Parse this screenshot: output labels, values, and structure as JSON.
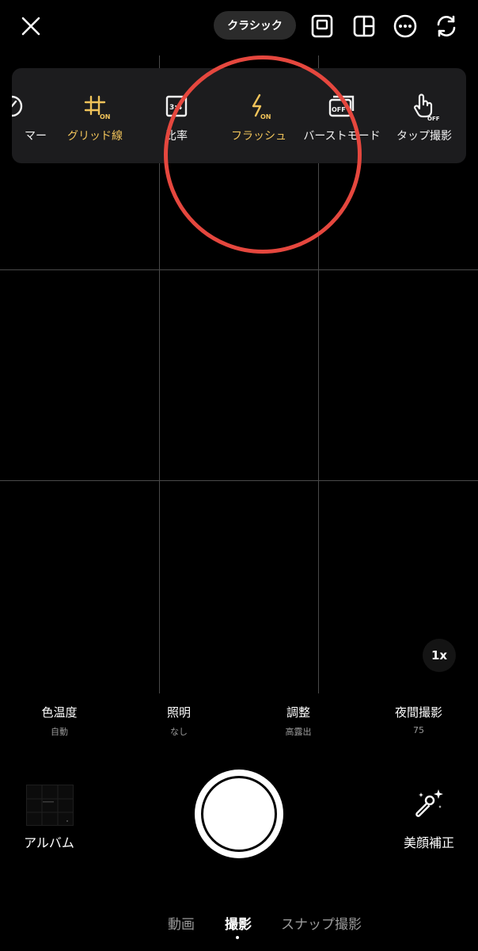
{
  "top_bar": {
    "close_icon": "close-icon",
    "mode_label": "クラシック",
    "icons": [
      "frame-ratio-icon",
      "layout-icon",
      "more-icon",
      "switch-camera-icon"
    ]
  },
  "settings_panel": {
    "items": [
      {
        "label": "マー",
        "icon": "timer-icon",
        "state": "",
        "active": false
      },
      {
        "label": "グリッド線",
        "icon": "grid-icon",
        "state": "ON",
        "active": true
      },
      {
        "label": "比率",
        "icon": "ratio-icon",
        "state": "3:4",
        "active": false
      },
      {
        "label": "フラッシュ",
        "icon": "flash-icon",
        "state": "ON",
        "active": true
      },
      {
        "label": "バーストモード",
        "icon": "burst-icon",
        "state": "OFF",
        "active": false
      },
      {
        "label": "タップ撮影",
        "icon": "tap-shoot-icon",
        "state": "OFF",
        "active": false
      }
    ],
    "highlight_color": "#e5473e",
    "active_color": "#f0c35a"
  },
  "zoom": {
    "label": "1x"
  },
  "controls": [
    {
      "title": "色温度",
      "value": "自動"
    },
    {
      "title": "照明",
      "value": "なし"
    },
    {
      "title": "調整",
      "value": "高露出"
    },
    {
      "title": "夜間撮影",
      "value": "75"
    }
  ],
  "bottom": {
    "album_label": "アルバム",
    "beauty_label": "美顔補正"
  },
  "mode_tabs": [
    {
      "label": "動画",
      "selected": false
    },
    {
      "label": "撮影",
      "selected": true
    },
    {
      "label": "スナップ撮影",
      "selected": false
    }
  ]
}
